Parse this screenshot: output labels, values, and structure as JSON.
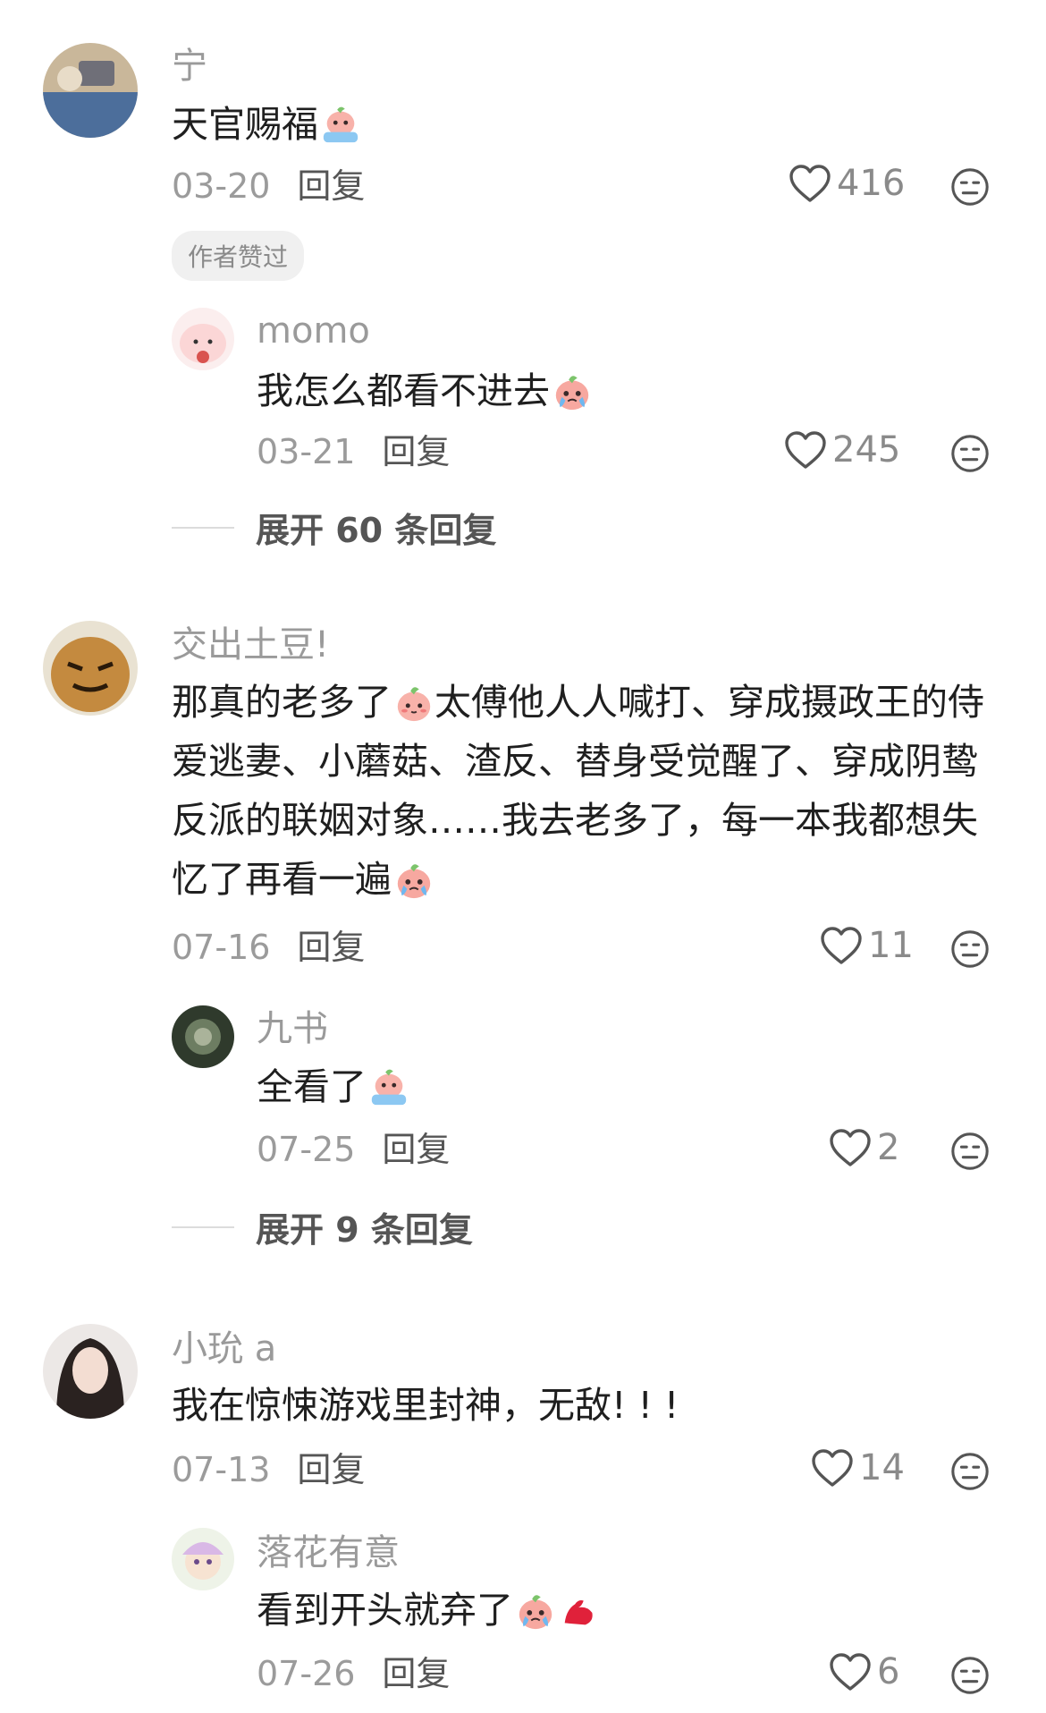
{
  "comments": [
    {
      "user": "宁",
      "text": "天官赐福",
      "date": "03-20",
      "reply_label": "回复",
      "likes": "416",
      "badge": "作者赞过",
      "replies": [
        {
          "user": "momo",
          "text": "我怎么都看不进去",
          "date": "03-21",
          "reply_label": "回复",
          "likes": "245"
        }
      ],
      "expand_label": "展开 60 条回复"
    },
    {
      "user": "交出土豆!",
      "text_lines": [
        "那真的老多了",
        "太傅他人人喊打、穿成摄政王的侍",
        "爱逃妻、小蘑菇、渣反、替身受觉醒了、穿成阴鸷",
        "反派的联姻对象……我去老多了，每一本我都想失",
        "忆了再看一遍"
      ],
      "date": "07-16",
      "reply_label": "回复",
      "likes": "11",
      "replies": [
        {
          "user": "九书",
          "text": "全看了",
          "date": "07-25",
          "reply_label": "回复",
          "likes": "2"
        }
      ],
      "expand_label": "展开 9 条回复"
    },
    {
      "user": "小玧 a",
      "text": "我在惊悚游戏里封神，无敌! ! !",
      "date": "07-13",
      "reply_label": "回复",
      "likes": "14",
      "replies": [
        {
          "user": "落花有意",
          "text": "看到开头就弃了",
          "date": "07-26",
          "reply_label": "回复",
          "likes": "6"
        }
      ]
    }
  ],
  "icons": {
    "like": "heart-outline-icon",
    "dislike": "neutral-face-icon",
    "emoji": "peach-crying-emoji"
  },
  "colors": {
    "name": "#9a9a9a",
    "text": "#1f1f1f",
    "meta": "#9b9b9b",
    "reply": "#555555"
  }
}
